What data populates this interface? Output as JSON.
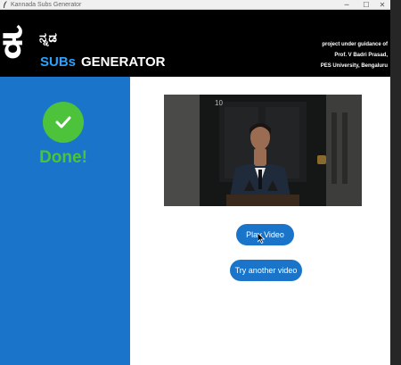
{
  "window": {
    "title": "Kannada Subs Generator",
    "controls": {
      "minimize": "─",
      "maximize": "☐",
      "close": "✕"
    }
  },
  "header": {
    "logo_big": "ಕ",
    "logo_small": "ನ್ನಡ",
    "logo_subs": "SUBs",
    "logo_generator": "GENERATOR",
    "credit_lines": [
      "project under guidance of",
      "Prof. V Badri Prasad,",
      "PES University, Bengaluru"
    ]
  },
  "sidebar": {
    "status_icon": "checkmark-icon",
    "status_text": "Done!"
  },
  "main": {
    "play_button": "Play Video",
    "another_button": "Try another video",
    "door_number": "10"
  },
  "colors": {
    "accent_blue": "#1a74c9",
    "success_green": "#4cc33a",
    "subs_blue": "#29a3ff",
    "header_bg": "#000000"
  }
}
